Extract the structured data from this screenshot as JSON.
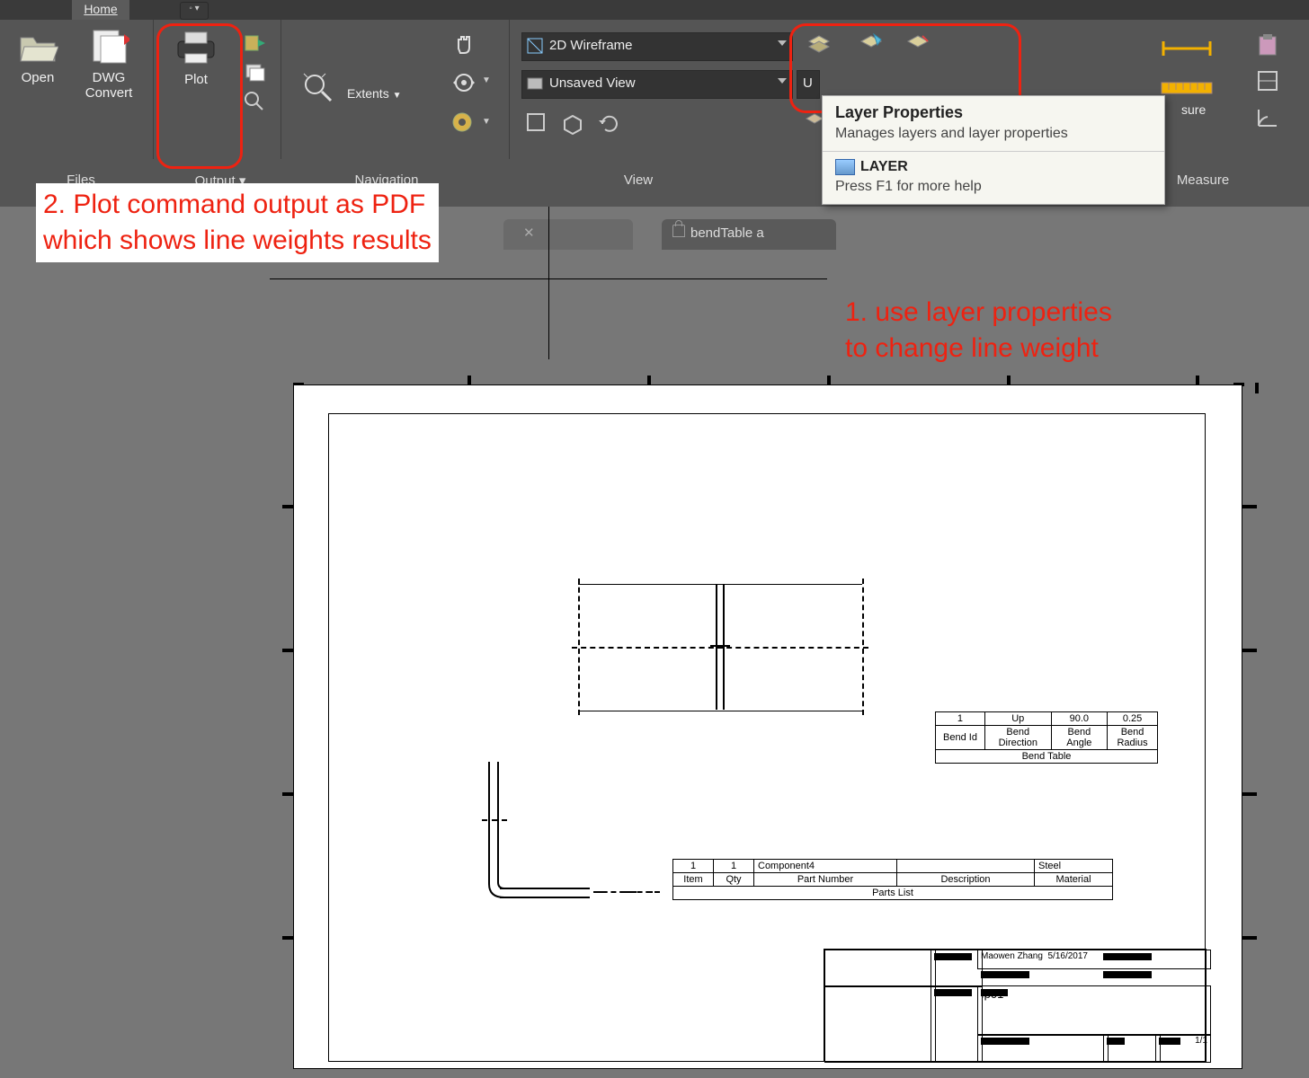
{
  "tabs": {
    "home": "Home"
  },
  "buttons": {
    "open": "Open",
    "dwg_convert": "DWG\nConvert",
    "plot": "Plot",
    "extents": "Extents"
  },
  "panels": {
    "files": "Files",
    "output": "Output  ▾",
    "navigation": "Navigation",
    "view": "View",
    "measure_right": "sure",
    "measure_full": "Measure"
  },
  "combos": {
    "visual_style": "2D Wireframe",
    "view_name": "Unsaved View",
    "layer_prefix": "U"
  },
  "tooltip": {
    "title": "Layer Properties",
    "body": "Manages layers and layer properties",
    "cmd": "LAYER",
    "help": "Press F1 for more help"
  },
  "doc_tabs": {
    "active_suffix": "",
    "inactive": "bendTable a"
  },
  "annotations": {
    "a2_l1": "2. Plot command output as PDF",
    "a2_l2": "which shows line weights results",
    "a1_l1": "1. use layer properties",
    "a1_l2": "to change line weight"
  },
  "bend_table": {
    "row": {
      "id": "1",
      "dir": "Up",
      "angle": "90.0",
      "radius": "0.25"
    },
    "hdr": {
      "id": "Bend Id",
      "dir": "Bend\nDirection",
      "angle": "Bend\nAngle",
      "radius": "Bend\nRadius"
    },
    "title": "Bend Table"
  },
  "parts_list": {
    "row": {
      "item": "1",
      "qty": "1",
      "pn": "Component4",
      "desc": "",
      "mat": "Steel"
    },
    "hdr": {
      "item": "Item",
      "qty": "Qty",
      "pn": "Part Number",
      "desc": "Description",
      "mat": "Material"
    },
    "title": "Parts List"
  },
  "titleblock": {
    "author": "Maowen Zhang",
    "date": "5/16/2017",
    "name": "fp01",
    "sheet": "1/1"
  }
}
